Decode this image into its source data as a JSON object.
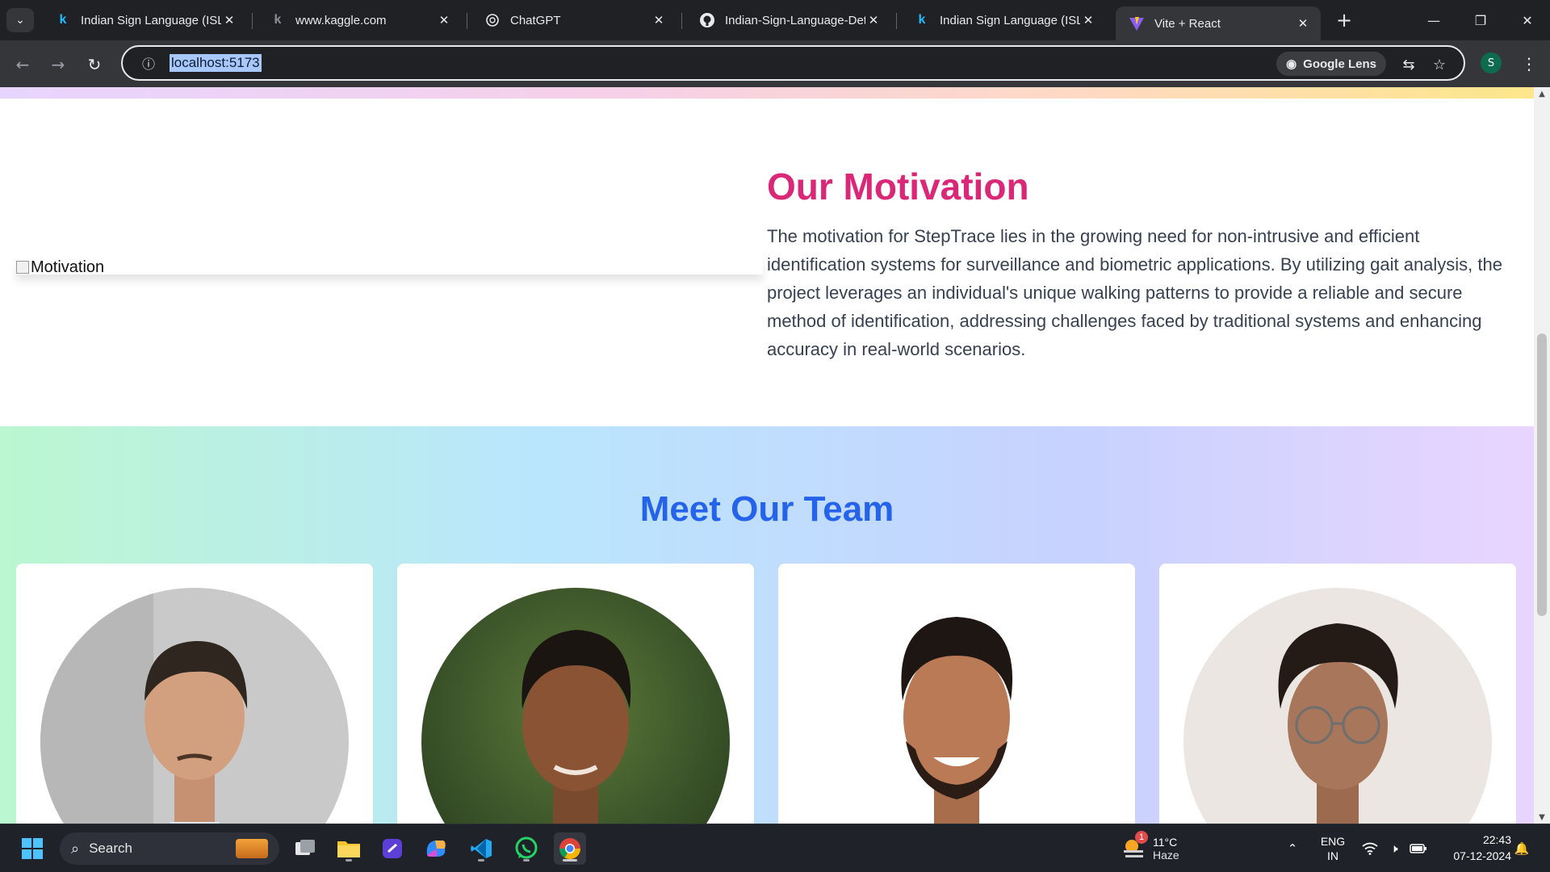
{
  "browser": {
    "tabs": [
      {
        "title": "Indian Sign Language (ISL)",
        "icon": "kaggle-icon"
      },
      {
        "title": "www.kaggle.com",
        "icon": "kaggle-icon"
      },
      {
        "title": "ChatGPT",
        "icon": "chatgpt-icon"
      },
      {
        "title": "Indian-Sign-Language-Det",
        "icon": "github-icon"
      },
      {
        "title": "Indian Sign Language (ISL)",
        "icon": "kaggle-icon"
      },
      {
        "title": "Vite + React",
        "icon": "vite-icon",
        "active": true
      }
    ],
    "url": "localhost:5173",
    "lens_label": "Google Lens",
    "profile_initial": "S"
  },
  "page": {
    "motivation": {
      "image_alt": "Motivation",
      "title": "Our Motivation",
      "text": "The motivation for StepTrace lies in the growing need for non-intrusive and efficient identification systems for surveillance and biometric applications. By utilizing gait analysis, the project leverages an individual's unique walking patterns to provide a reliable and secure method of identification, addressing challenges faced by traditional systems and enhancing accuracy in real-world scenarios."
    },
    "team": {
      "title": "Meet Our Team",
      "members": [
        {
          "photo": "team-member-photo-1"
        },
        {
          "photo": "team-member-photo-2"
        },
        {
          "photo": "team-member-photo-3"
        },
        {
          "photo": "team-member-photo-4"
        }
      ]
    }
  },
  "taskbar": {
    "search_label": "Search",
    "weather": {
      "temp": "11°C",
      "condition": "Haze",
      "badge": "1"
    },
    "language": {
      "line1": "ENG",
      "line2": "IN"
    },
    "time": "22:43",
    "date": "07-12-2024"
  },
  "colors": {
    "motivation_title": "#db2777",
    "team_title": "#2563eb",
    "chrome_bg": "#202124"
  }
}
